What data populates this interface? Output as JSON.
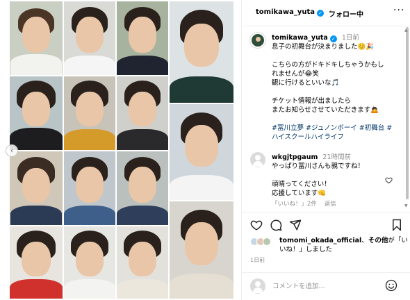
{
  "post_header": {
    "username": "tomikawa_yuta",
    "verified_mark": "✓",
    "separator": "•",
    "follow_label": "フォロー中",
    "more_icon": "more-horizontal-icon",
    "more_glyph": "···"
  },
  "caption": {
    "username": "tomikawa_yuta",
    "verified_mark": "✓",
    "time": "1日前",
    "lines": [
      "息子の初舞台が決まりました☺️🎉",
      "",
      "こちらの方がドキドキしちゃうかもし",
      "れませんが😂笑",
      "観に行けるといいな🎵",
      "",
      "チケット情報が出ましたら",
      "またお知らせさせていただきます🙇",
      ""
    ],
    "hashtags": [
      "#冨川立夢 #ジュノンボーイ #初舞台 #",
      "ハイスクールハイライフ"
    ]
  },
  "comment": {
    "username": "wkgjtpgaum",
    "time": "21時間前",
    "lines": [
      "やっぱり冨川さんも親ですね！",
      "",
      "頑晴ってください！",
      "応援しています👊"
    ],
    "likes_label": "「いいね！」2件",
    "reply_label": "返信"
  },
  "actions": {
    "like_icon": "heart-icon",
    "comment_icon": "comment-icon",
    "share_icon": "share-icon",
    "save_icon": "bookmark-icon"
  },
  "likes": {
    "first_user": "tomomi_okada_official",
    "connector": "、",
    "others": "その他",
    "suffix_1": "が「い",
    "suffix_2": "いね！」しました"
  },
  "timestamp": "1日前",
  "add_comment": {
    "placeholder": "コメントを追加...",
    "emoji_icon": "smiley-icon"
  },
  "carousel": {
    "prev_icon": "chevron-left-icon",
    "prev_glyph": "‹"
  },
  "scroll_arrows": {
    "up": "▲",
    "down": "▼"
  },
  "colors": {
    "link": "#00376b",
    "verified": "#0095f6",
    "muted": "#8e8e8e",
    "border": "#efefef"
  }
}
